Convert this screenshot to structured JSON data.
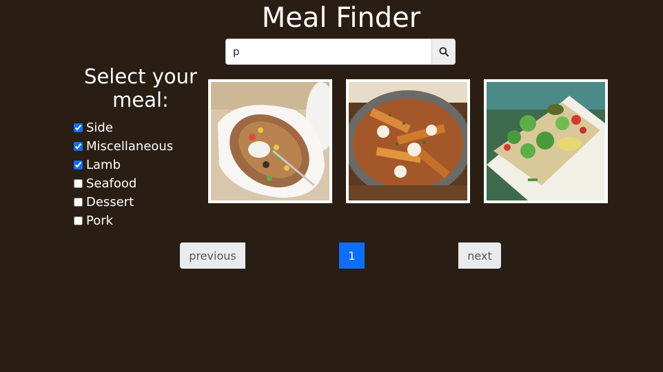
{
  "header": {
    "title": "Meal Finder"
  },
  "search": {
    "value": "p",
    "button_icon": "search-icon"
  },
  "sidebar": {
    "title": "Select your meal:",
    "categories": [
      {
        "label": "Side",
        "checked": true
      },
      {
        "label": "Miscellaneous",
        "checked": true
      },
      {
        "label": "Lamb",
        "checked": true
      },
      {
        "label": "Seafood",
        "checked": false
      },
      {
        "label": "Dessert",
        "checked": false
      },
      {
        "label": "Pork",
        "checked": false
      }
    ]
  },
  "meals": [
    {
      "image": "baked-potato-photo"
    },
    {
      "image": "poutine-fries-photo"
    },
    {
      "image": "salad-flatbread-photo"
    }
  ],
  "pagination": {
    "previous_label": "previous",
    "current_page": "1",
    "next_label": "next"
  },
  "colors": {
    "background": "#2a1d13",
    "accent": "#0d6efd",
    "checkbox": "#0d6efd"
  }
}
